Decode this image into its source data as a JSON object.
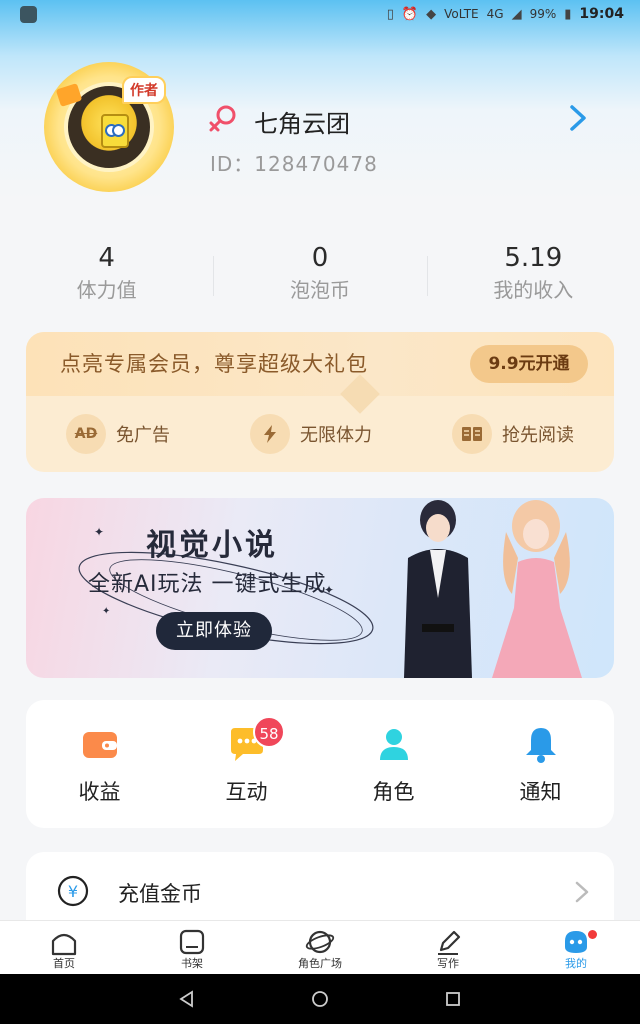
{
  "status_bar": {
    "battery": "99%",
    "network": "4G",
    "volte": "VoLTE",
    "time": "19:04"
  },
  "profile": {
    "author_badge": "作者",
    "username": "七角云团",
    "user_id": "ID：128470478"
  },
  "stats": [
    {
      "value": "4",
      "label": "体力值"
    },
    {
      "value": "0",
      "label": "泡泡币"
    },
    {
      "value": "5.19",
      "label": "我的收入"
    }
  ],
  "vip": {
    "title": "点亮专属会员，尊享超级大礼包",
    "button": "9.9元开通",
    "features": [
      {
        "icon": "AD",
        "label": "免广告"
      },
      {
        "icon": "bolt-icon",
        "label": "无限体力"
      },
      {
        "icon": "book-icon",
        "label": "抢先阅读"
      }
    ]
  },
  "banner": {
    "title": "视觉小说",
    "subtitle": "全新AI玩法 一键式生成",
    "button": "立即体验"
  },
  "actions": [
    {
      "label": "收益",
      "icon": "wallet-icon"
    },
    {
      "label": "互动",
      "icon": "chat-icon",
      "badge": "58"
    },
    {
      "label": "角色",
      "icon": "person-icon"
    },
    {
      "label": "通知",
      "icon": "bell-icon"
    }
  ],
  "list": {
    "recharge_label": "充值金币"
  },
  "tabs": [
    {
      "label": "首页",
      "icon": "home-icon"
    },
    {
      "label": "书架",
      "icon": "bookshelf-icon"
    },
    {
      "label": "角色广场",
      "icon": "planet-icon"
    },
    {
      "label": "写作",
      "icon": "pen-icon"
    },
    {
      "label": "我的",
      "icon": "profile-icon",
      "active": true
    }
  ],
  "colors": {
    "accent": "#2a9ae8",
    "vip_text": "#8a5a2a",
    "badge": "#f0475a"
  }
}
